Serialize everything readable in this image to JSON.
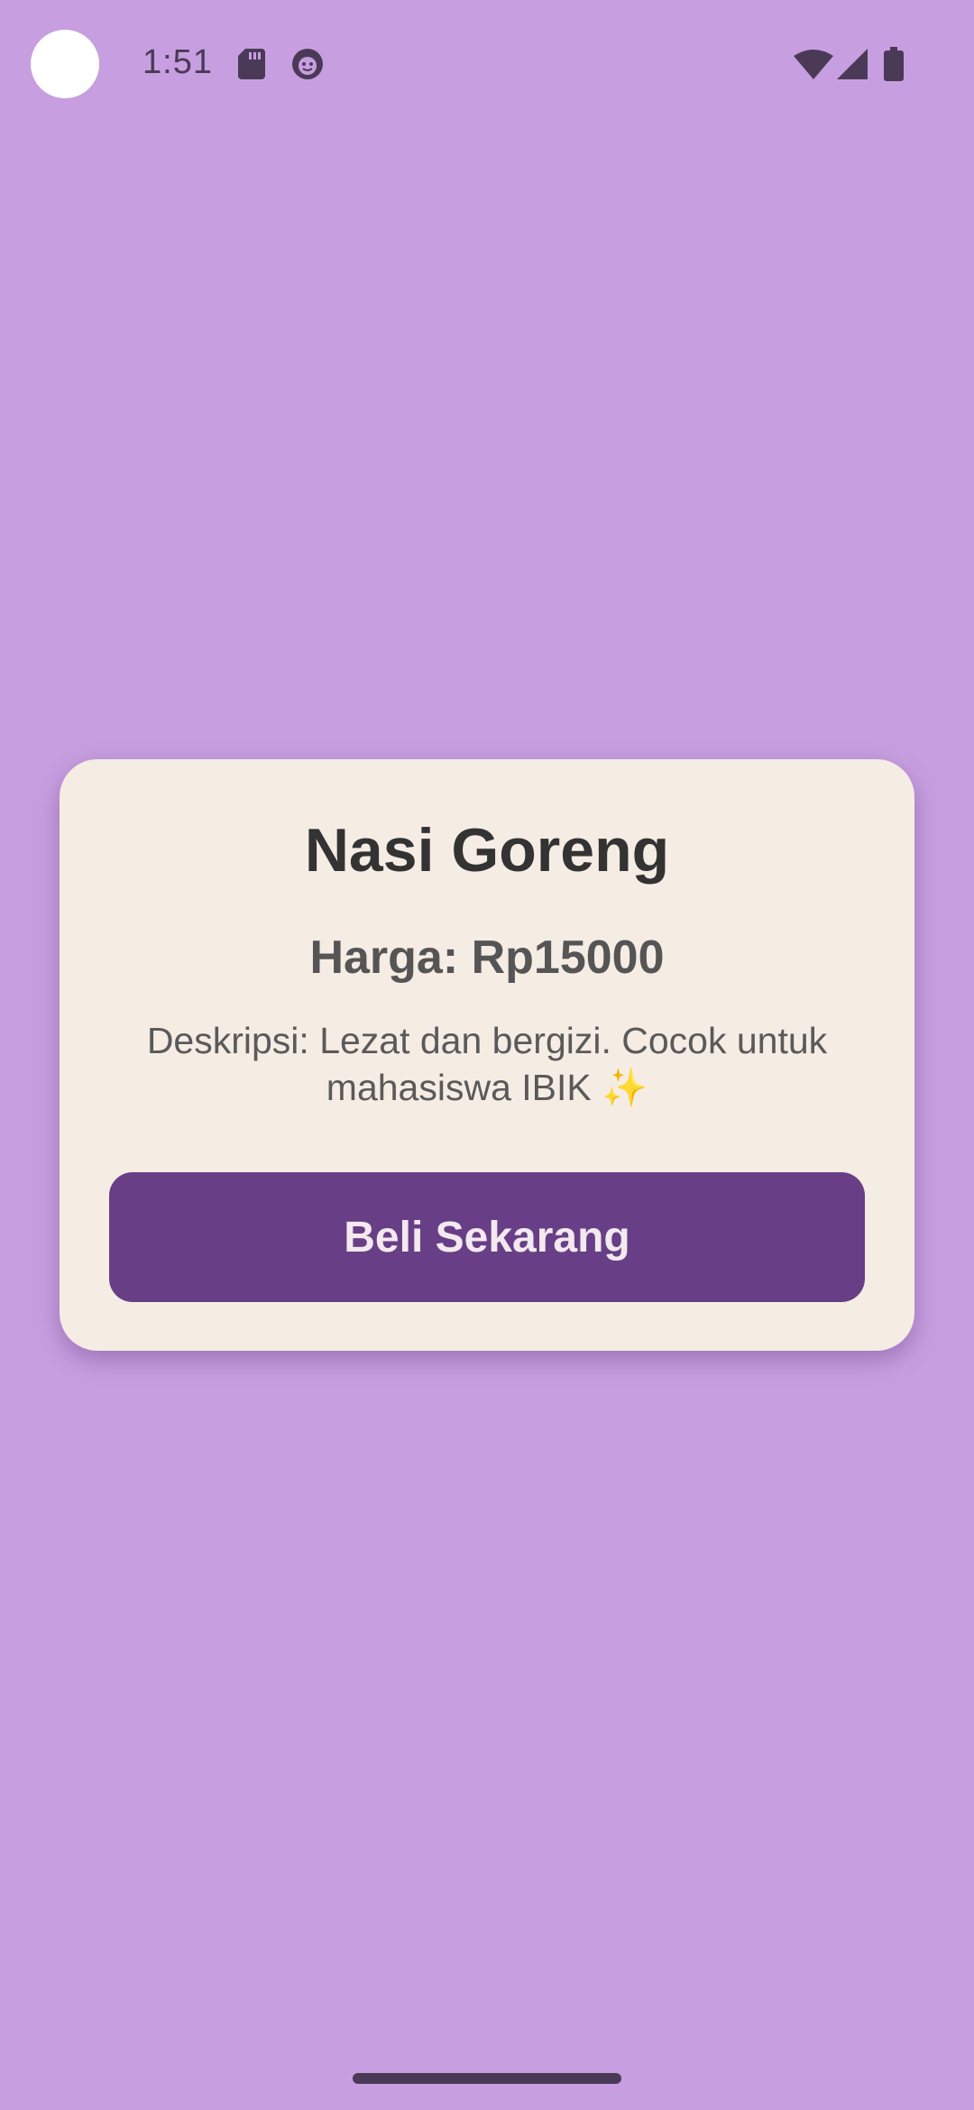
{
  "status_bar": {
    "time": "1:51",
    "icons": [
      "sd-card-icon",
      "face-icon",
      "wifi-icon",
      "cellular-signal-icon",
      "battery-icon"
    ]
  },
  "colors": {
    "background": "#c79fe0",
    "card": "#f5ece4",
    "button": "#683f86",
    "button_text": "#f3e9ee"
  },
  "product": {
    "name": "Nasi Goreng",
    "price": "Harga: Rp15000",
    "description": "Deskripsi: Lezat dan bergizi. Cocok untuk mahasiswa IBIK ✨",
    "buy_label": "Beli Sekarang"
  }
}
